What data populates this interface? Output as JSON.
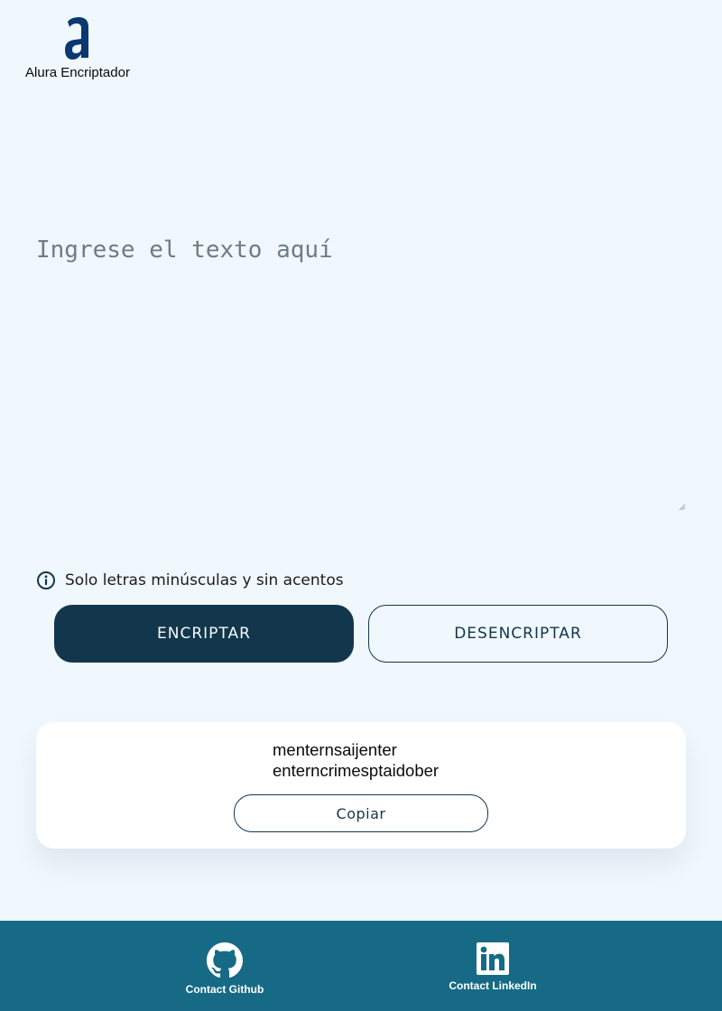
{
  "header": {
    "brand_name": "Alura Encriptador",
    "logo_icon": "alura-a-logo-icon"
  },
  "input": {
    "placeholder": "Ingrese el texto aquí",
    "value": ""
  },
  "hint": {
    "icon": "info-icon",
    "text": "Solo letras minúsculas y sin acentos"
  },
  "actions": {
    "encrypt_label": "ENCRIPTAR",
    "decrypt_label": "DESENCRIPTAR"
  },
  "result": {
    "lines": [
      "menternsaijenter",
      "enterncrimesptaidober"
    ],
    "copy_label": "Copiar"
  },
  "footer": {
    "github_label": "Contact Github",
    "github_icon": "github-icon",
    "linkedin_label": "Contact LinkedIn",
    "linkedin_icon": "linkedin-icon"
  },
  "colors": {
    "background": "#f0f7fd",
    "primary": "#12374d",
    "logo": "#0a3871",
    "footer": "#166a86",
    "card": "#ffffff"
  }
}
